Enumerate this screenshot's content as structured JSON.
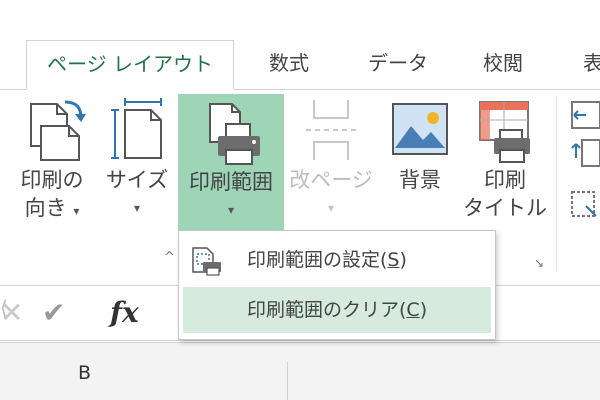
{
  "tabs": [
    {
      "label": "ページ レイアウト",
      "active": true
    },
    {
      "label": "数式",
      "active": false
    },
    {
      "label": "データ",
      "active": false
    },
    {
      "label": "校閲",
      "active": false
    },
    {
      "label": "表",
      "active": false
    }
  ],
  "ribbon": {
    "orientation": {
      "line1": "印刷の",
      "line2": "向き",
      "caret": "▾",
      "icon": "page-orientation-icon"
    },
    "size": {
      "line1": "サイズ",
      "caret": "▾",
      "icon": "page-size-icon"
    },
    "print_area": {
      "line1": "印刷範囲",
      "caret": "▾",
      "icon": "printer-icon",
      "pressed": true
    },
    "breaks": {
      "line1": "改ページ",
      "caret": "▾",
      "icon": "page-break-icon",
      "disabled": true
    },
    "background": {
      "line1": "背景",
      "icon": "background-image-icon"
    },
    "print_titles": {
      "line1": "印刷",
      "line2": "タイトル",
      "icon": "print-titles-icon"
    },
    "collapse_mark": "^",
    "launcher": "↘"
  },
  "print_area_menu": [
    {
      "label": "印刷範囲の設定(",
      "key": "S",
      "close": ")",
      "icon": "set-print-area-icon",
      "highlighted": false
    },
    {
      "label": "印刷範囲のクリア(",
      "key": "C",
      "close": ")",
      "icon": "",
      "highlighted": true
    }
  ],
  "formula_bar": {
    "cancel": "✕",
    "enter": "✔",
    "fx": "fx"
  },
  "column_headers": [
    "B"
  ],
  "colors": {
    "accent": "#217346",
    "pressed": "#9fd5b7",
    "menu_highlight": "#d6ebde"
  }
}
